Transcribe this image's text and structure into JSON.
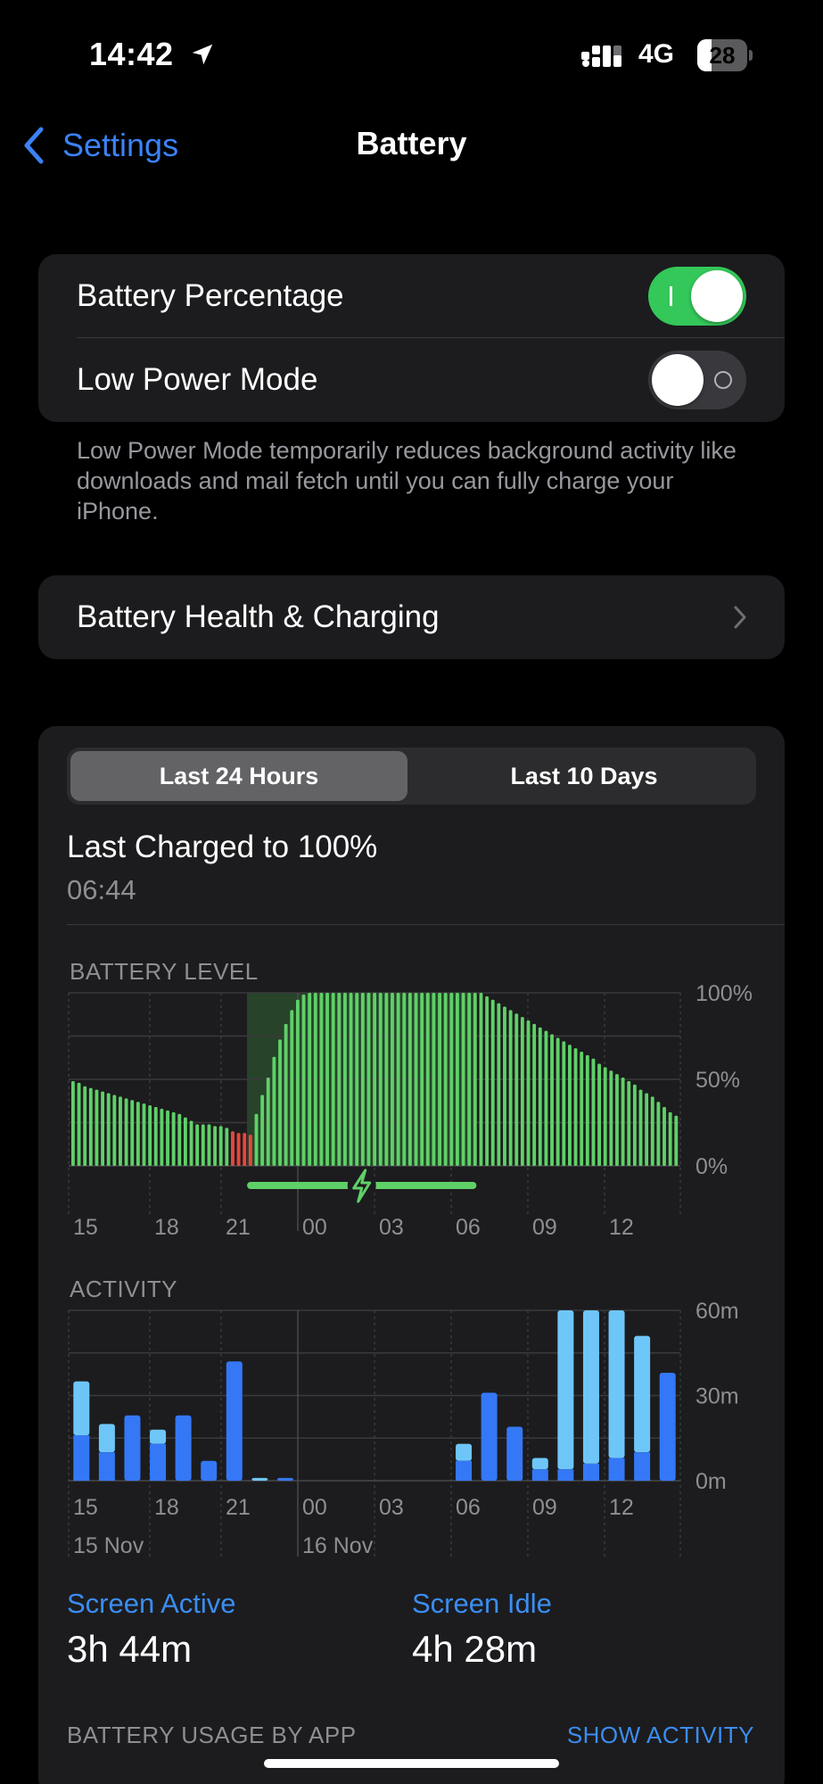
{
  "status_bar": {
    "time": "14:42",
    "network": "4G",
    "battery_percent": "28",
    "battery_level": 0.28,
    "icons": [
      "location-arrow-icon",
      "signal-bars-icon",
      "battery-icon"
    ]
  },
  "nav": {
    "back_label": "Settings",
    "title": "Battery"
  },
  "settings": {
    "battery_percentage": {
      "label": "Battery Percentage",
      "enabled": true
    },
    "low_power_mode": {
      "label": "Low Power Mode",
      "enabled": false
    },
    "footnote": "Low Power Mode temporarily reduces background activity like downloads and mail fetch until you can fully charge your iPhone."
  },
  "health": {
    "label": "Battery Health & Charging"
  },
  "usage": {
    "tabs": [
      {
        "label": "Last 24 Hours",
        "selected": true
      },
      {
        "label": "Last 10 Days",
        "selected": false
      }
    ],
    "last_charged_label": "Last Charged to 100%",
    "last_charged_time": "06:44",
    "battery_level_label": "BATTERY LEVEL",
    "activity_label": "ACTIVITY",
    "date_labels": [
      "15 Nov",
      "16 Nov"
    ],
    "screen_active_label": "Screen Active",
    "screen_active_value": "3h 44m",
    "screen_idle_label": "Screen Idle",
    "screen_idle_value": "4h 28m",
    "by_app_label": "BATTERY USAGE BY APP",
    "show_activity_label": "SHOW ACTIVITY"
  },
  "colors": {
    "accent": "#3b8df2",
    "toggle_on": "#34c759",
    "battery_bar": "#5fd068",
    "battery_low": "#e5483d",
    "activity_dark": "#3478f6",
    "activity_light": "#6ec6f8"
  },
  "chart_data": [
    {
      "type": "bar",
      "title": "BATTERY LEVEL",
      "x_tick_labels": [
        "15",
        "18",
        "21",
        "00",
        "03",
        "06",
        "09",
        "12"
      ],
      "y_tick_labels": [
        "100%",
        "50%",
        "0%"
      ],
      "ylim": [
        0,
        100
      ],
      "charging_window": {
        "start_hour": 21.0,
        "end_hour": 6.0
      },
      "low_power_threshold": 20,
      "values": [
        49,
        48,
        46,
        45,
        44,
        43,
        42,
        41,
        40,
        39,
        38,
        37,
        36,
        35,
        34,
        33,
        32,
        31,
        30,
        28,
        26,
        24,
        24,
        24,
        23,
        23,
        22,
        20,
        19,
        19,
        18,
        30,
        41,
        51,
        63,
        73,
        82,
        90,
        96,
        99,
        100,
        100,
        100,
        100,
        100,
        100,
        100,
        100,
        100,
        100,
        100,
        100,
        100,
        100,
        100,
        100,
        100,
        100,
        100,
        100,
        100,
        100,
        100,
        100,
        100,
        100,
        100,
        100,
        100,
        100,
        98,
        96,
        94,
        92,
        90,
        88,
        86,
        84,
        82,
        80,
        78,
        76,
        74,
        72,
        70,
        68,
        66,
        64,
        62,
        59,
        57,
        55,
        53,
        51,
        49,
        47,
        44,
        42,
        40,
        37,
        34,
        31,
        29
      ]
    },
    {
      "type": "bar",
      "title": "ACTIVITY",
      "x_tick_labels": [
        "15",
        "18",
        "21",
        "00",
        "03",
        "06",
        "09",
        "12"
      ],
      "y_tick_labels": [
        "60m",
        "30m",
        "0m"
      ],
      "ylim": [
        0,
        60
      ],
      "series": [
        {
          "name": "Screen Active",
          "values": [
            16,
            10,
            23,
            13,
            23,
            7,
            42,
            0,
            1,
            0,
            0,
            0,
            0,
            0,
            0,
            7,
            31,
            19,
            4,
            4,
            6,
            8,
            10,
            38
          ]
        },
        {
          "name": "Screen Idle",
          "values": [
            19,
            10,
            0,
            5,
            0,
            0,
            0,
            1,
            0,
            0,
            0,
            0,
            0,
            0,
            0,
            6,
            0,
            0,
            4,
            56,
            54,
            52,
            41,
            0
          ]
        }
      ]
    }
  ]
}
